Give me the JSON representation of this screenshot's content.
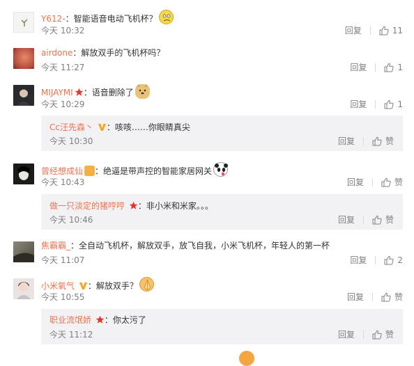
{
  "ui": {
    "reply_label": "回复",
    "like_label": "赞",
    "colon": "："
  },
  "comments": [
    {
      "user": "Y612-",
      "text": "智能语音电动飞机杯？",
      "time": "今天 10:32",
      "likes": "11"
    },
    {
      "user": "airdone",
      "text": "解放双手的飞机杯吗？",
      "time": "今天 11:27",
      "likes": "1"
    },
    {
      "user": "MIJAYMI",
      "text": "语音删除了",
      "time": "今天 10:29",
      "likes": "1"
    },
    {
      "user": "曾经想成仙",
      "text": "绝逼是带声控的智能家居网关",
      "time": "今天 10:43",
      "likes": "赞"
    },
    {
      "user": "焦霸霸_",
      "text": "全自动飞机杯，解放双手，放飞自我，小米飞机杯，年轻人的第一杯",
      "time": "今天 11:07",
      "likes": "2"
    },
    {
      "user": "小米氧气",
      "text": "解放双手？",
      "time": "今天 10:55",
      "likes": "赞"
    }
  ],
  "replies": [
    {
      "user": "Cc汪先森丶",
      "text": "咳咳……你眼睛真尖",
      "time": "今天 10:30",
      "likes": "赞"
    },
    {
      "user": "做一只淡定的猪哼哼",
      "text": "非小米和米家。。。",
      "time": "今天 10:46",
      "likes": "赞"
    },
    {
      "user": "职业流氓娇",
      "text": "你太污了",
      "time": "今天 11:12",
      "likes": "赞"
    }
  ],
  "colors": {
    "username": "#eb7350",
    "text": "#333333",
    "meta": "#808080",
    "reply_bg": "#f2f2f5",
    "vip_star": "#e8352b"
  }
}
